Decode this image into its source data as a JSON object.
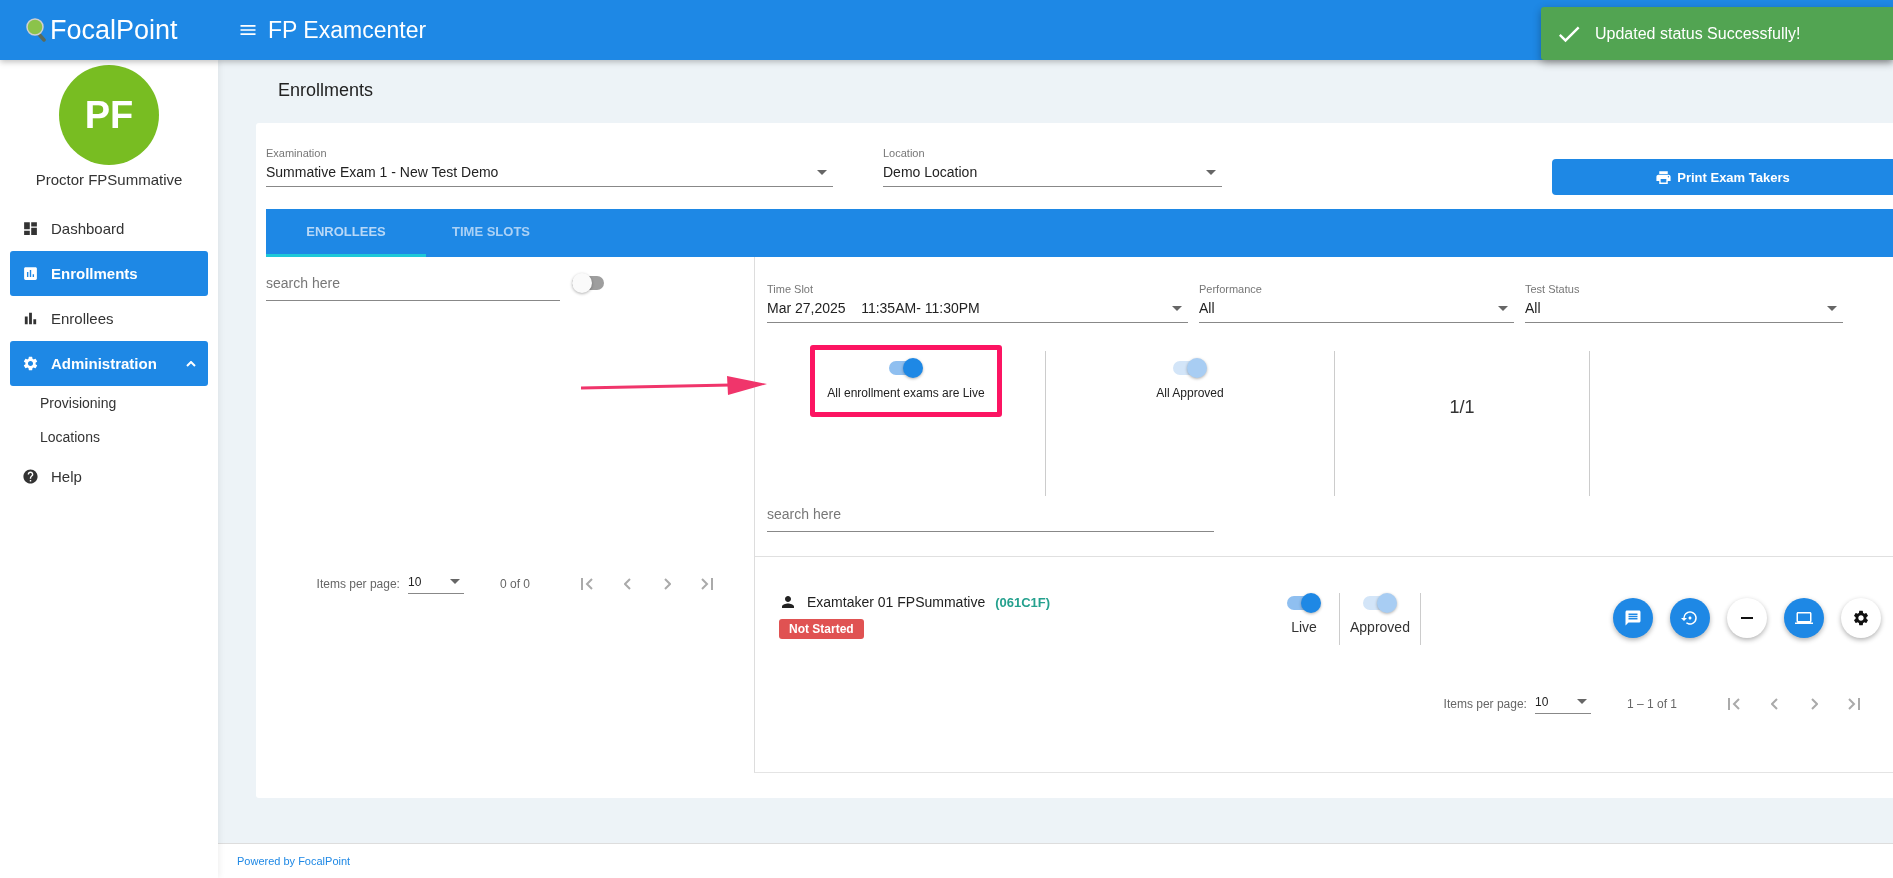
{
  "header": {
    "logo": "FocalPoint",
    "title": "FP Examcenter"
  },
  "toast": {
    "message": "Updated status Successfully!"
  },
  "sidebar": {
    "avatar_initials": "PF",
    "user_name": "Proctor FPSummative",
    "items": [
      {
        "label": "Dashboard",
        "selected": false
      },
      {
        "label": "Enrollments",
        "selected": true
      },
      {
        "label": "Enrollees",
        "selected": false
      },
      {
        "label": "Administration",
        "selected": true,
        "expanded": true,
        "children": [
          {
            "label": "Provisioning",
            "selected": false
          },
          {
            "label": "Locations",
            "selected": false
          }
        ]
      },
      {
        "label": "Help",
        "selected": false
      }
    ]
  },
  "page_title": "Enrollments",
  "filters": [
    {
      "label": "Examination",
      "value": "Summative Exam 1 - New Test Demo"
    },
    {
      "label": "Location",
      "value": "Demo Location"
    }
  ],
  "print_button": "Print Exam Takers",
  "tabs": [
    {
      "label": "ENROLLEES",
      "selected": true
    },
    {
      "label": "TIME SLOTS",
      "selected": false
    }
  ],
  "left_panel": {
    "search": {
      "placeholder": "search here"
    },
    "toggle": {
      "on": false
    },
    "pagination": {
      "label": "Items per page:",
      "page_size": "10",
      "range": "0 of 0"
    }
  },
  "right_panel": {
    "filters": [
      {
        "label": "Time Slot",
        "value": "Mar 27,2025    11:35AM- 11:30PM"
      },
      {
        "label": "Performance",
        "value": "All"
      },
      {
        "label": "Test Status",
        "value": "All"
      }
    ],
    "summary": [
      {
        "kind": "toggle",
        "label": "All enrollment exams are Live",
        "on": true,
        "disabled": false,
        "highlighted": true
      },
      {
        "kind": "toggle",
        "label": "All Approved",
        "on": true,
        "disabled": true,
        "highlighted": false
      },
      {
        "kind": "count",
        "text": "1/1"
      }
    ],
    "search": {
      "placeholder": "search here"
    },
    "enrollees": [
      {
        "name": "Examtaker 01 FPSummative",
        "code": "(061C1F)",
        "status": "Not Started",
        "toggles": [
          {
            "label": "Live",
            "on": true,
            "disabled": false
          },
          {
            "label": "Approved",
            "on": true,
            "disabled": true
          }
        ],
        "actions": [
          {
            "active": true
          },
          {
            "active": true
          },
          {
            "active": false
          },
          {
            "active": true
          },
          {
            "active": false
          }
        ]
      }
    ],
    "pagination": {
      "label": "Items per page:",
      "page_size": "10",
      "range": "1 – 1 of 1"
    }
  },
  "footer": "Powered by FocalPoint"
}
